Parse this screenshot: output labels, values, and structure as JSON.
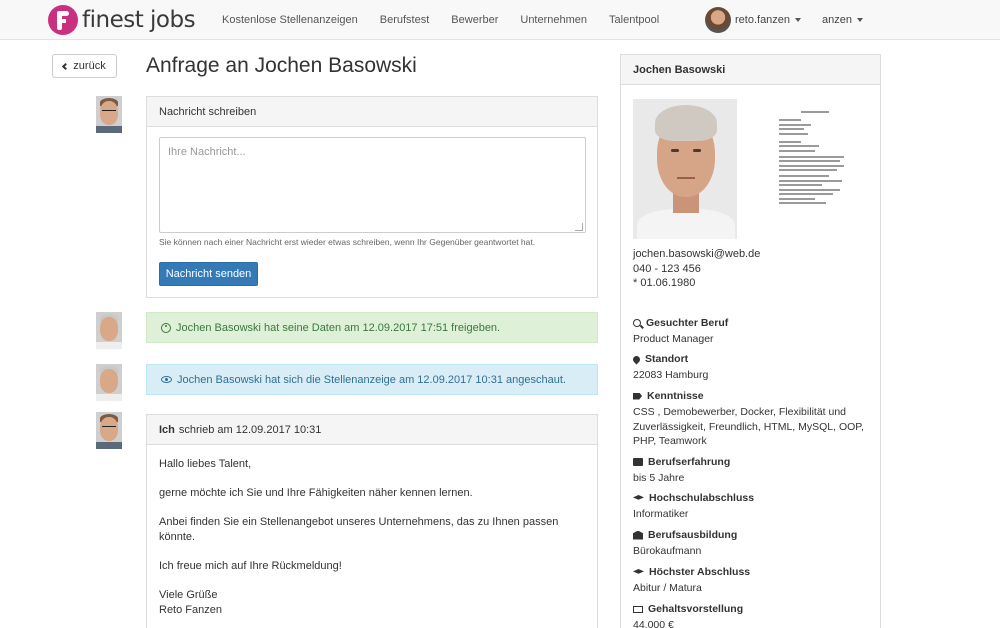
{
  "brand": {
    "name": "finest jobs",
    "color": "#c9307f"
  },
  "nav": {
    "items": [
      "Kostenlose Stellenanzeigen",
      "Berufstest",
      "Bewerber",
      "Unternehmen",
      "Talentpool"
    ]
  },
  "user": {
    "name": "reto.fanzen"
  },
  "lang": {
    "label": "anzen"
  },
  "page": {
    "back_label": "zurück",
    "title": "Anfrage an Jochen Basowski"
  },
  "compose": {
    "header": "Nachricht schreiben",
    "placeholder": "Ihre Nachricht...",
    "hint": "Sie können nach einer Nachricht erst wieder etwas schreiben, wenn Ihr Gegenüber geantwortet hat.",
    "send_label": "Nachricht senden",
    "button_color": "#337ab7"
  },
  "events": {
    "released": "Jochen Basowski hat seine Daten am 12.09.2017 17:51 freigeben.",
    "viewed": "Jochen Basowski hat sich die Stellenanzeige am 12.09.2017 10:31 angeschaut."
  },
  "message": {
    "author": "Ich",
    "meta": "schrieb am 12.09.2017 10:31",
    "lines": [
      "Hallo liebes Talent,",
      "gerne möchte ich Sie und Ihre Fähigkeiten näher kennen lernen.",
      "Anbei finden Sie ein Stellenangebot unseres Unternehmens, das zu Ihnen passen könnte.",
      "Ich freue mich auf Ihre Rückmeldung!"
    ],
    "closing": "Viele Grüße",
    "signature": "Reto Fanzen"
  },
  "profile": {
    "name": "Jochen Basowski",
    "email": "jochen.basowski@web.de",
    "phone": "040 - 123 456",
    "birth": "* 01.06.1980",
    "fields": [
      {
        "icon": "search-icon",
        "label": "Gesuchter Beruf",
        "value": "Product Manager"
      },
      {
        "icon": "map-marker-icon",
        "label": "Standort",
        "value": "22083 Hamburg"
      },
      {
        "icon": "tags-icon",
        "label": "Kenntnisse",
        "value": "CSS , Demobewerber, Docker, Flexibilität und Zuverlässigkeit, Freundlich, HTML, MySQL, OOP, PHP, Teamwork"
      },
      {
        "icon": "briefcase-icon",
        "label": "Berufserfahrung",
        "value": "bis 5 Jahre"
      },
      {
        "icon": "graduation-cap-icon",
        "label": "Hochschulabschluss",
        "value": "Informatiker"
      },
      {
        "icon": "bank-icon",
        "label": "Berufsausbildung",
        "value": "Bürokaufmann"
      },
      {
        "icon": "graduation-cap-icon",
        "label": "Höchster Abschluss",
        "value": "Abitur / Matura"
      },
      {
        "icon": "money-icon",
        "label": "Gehaltsvorstellung",
        "value": "44.000 €"
      }
    ]
  }
}
